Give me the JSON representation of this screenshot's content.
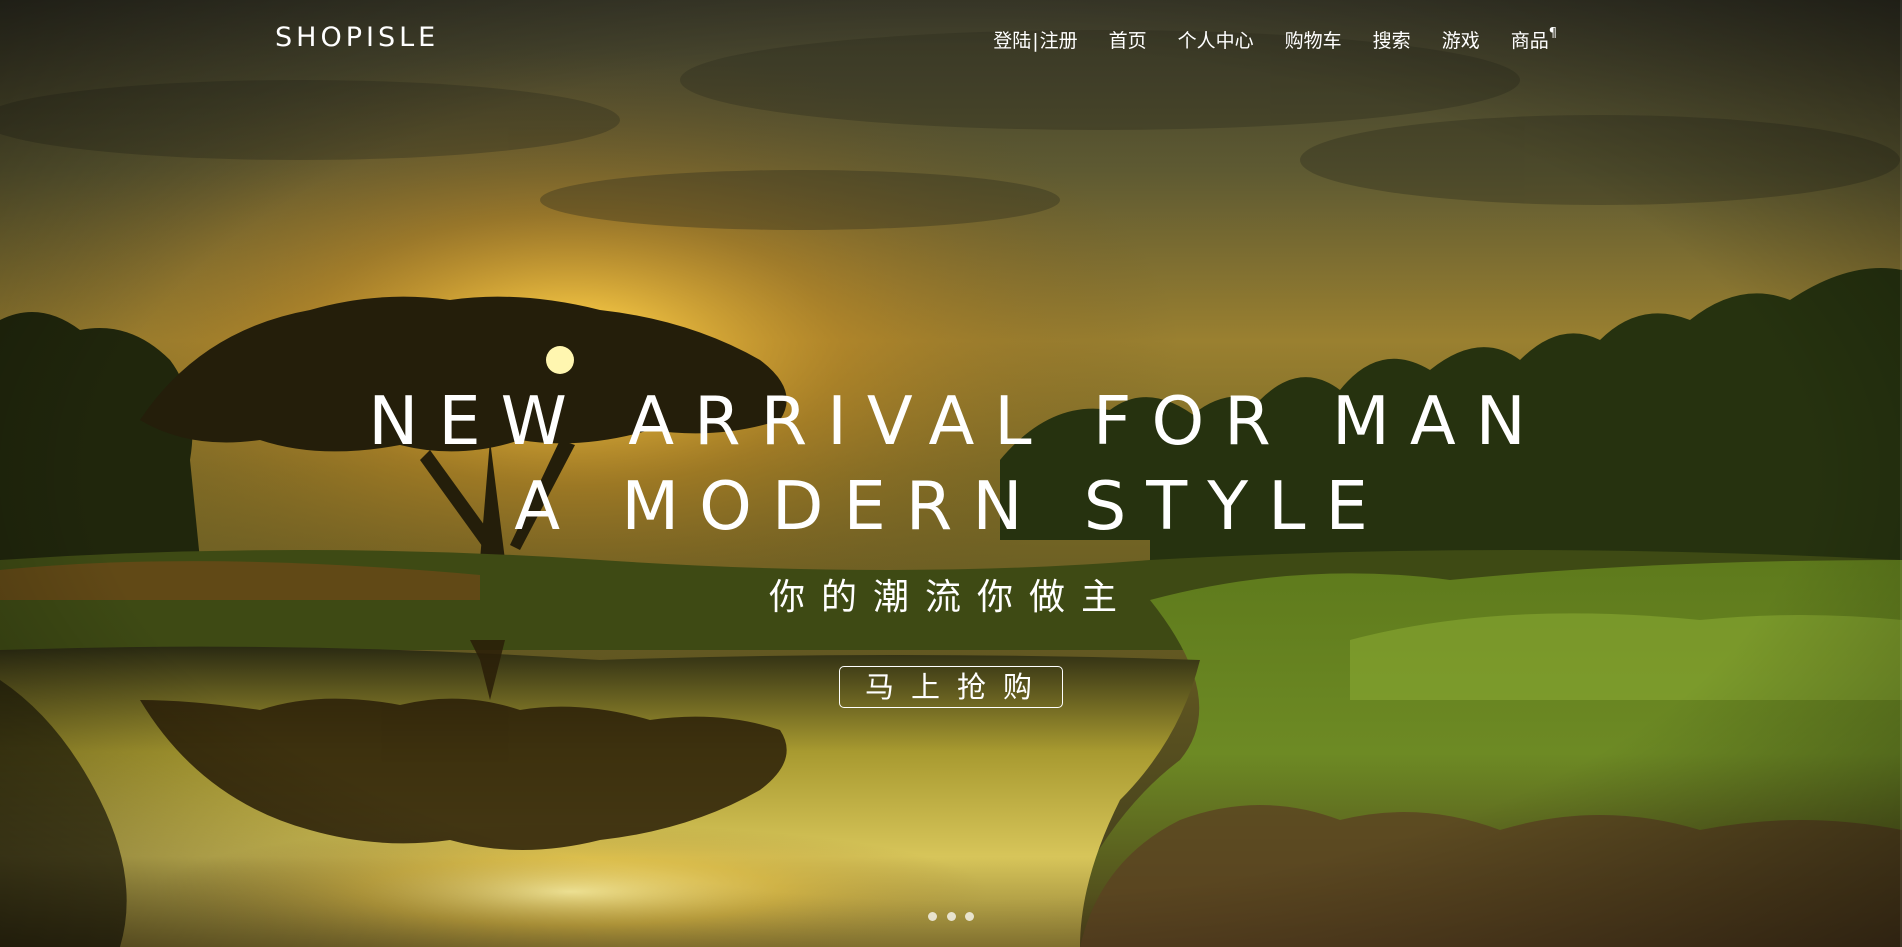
{
  "brand": {
    "logo_text": "SHOPISLE"
  },
  "nav": {
    "items": [
      {
        "label_login": "登陆",
        "separator": "|",
        "label_register": "注册"
      },
      {
        "label": "首页"
      },
      {
        "label": "个人中心"
      },
      {
        "label": "购物车"
      },
      {
        "label": "搜索"
      },
      {
        "label": "游戏"
      },
      {
        "label": "商品"
      }
    ],
    "dropdown_marker": "¶"
  },
  "hero": {
    "headline_line1": "NEW ARRIVAL FOR MAN",
    "headline_line2": "A MODERN STYLE",
    "tagline": "你的潮流你做主",
    "cta_label": "马上抢购",
    "slide_count": 3,
    "active_slide": 1
  },
  "colors": {
    "text": "#ffffff",
    "sky_top": "#3a3a28",
    "sun_glow": "#e8b830",
    "foliage": "#4e6a1a",
    "water": "#d6c24a"
  }
}
